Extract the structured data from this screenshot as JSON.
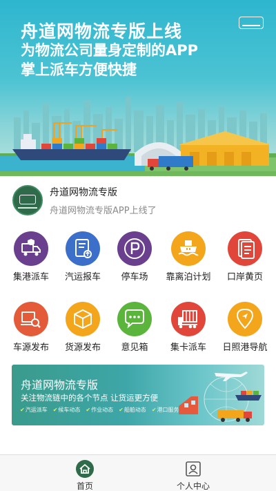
{
  "hero": {
    "line1": "舟道网物流专版上线",
    "line2": "为物流公司量身定制的APP",
    "line3": "掌上派车方便快捷"
  },
  "notice": {
    "title": "舟道网物流专版",
    "subtitle": "舟道网物流专版APP上线了"
  },
  "grid": [
    {
      "label": "集港派车",
      "icon": "truck-shield-icon",
      "color": "#6a3f8e"
    },
    {
      "label": "汽运报车",
      "icon": "document-upload-icon",
      "color": "#3b6fc9"
    },
    {
      "label": "停车场",
      "icon": "parking-icon",
      "color": "#6a3f8e"
    },
    {
      "label": "靠离泊计划",
      "icon": "ship-icon",
      "color": "#f3a51c"
    },
    {
      "label": "口岸黄页",
      "icon": "documents-icon",
      "color": "#e0473a"
    },
    {
      "label": "车源发布",
      "icon": "truck-search-icon",
      "color": "#e45b3a"
    },
    {
      "label": "货源发布",
      "icon": "cargo-box-icon",
      "color": "#f3a51c"
    },
    {
      "label": "意见箱",
      "icon": "chat-bubbles-icon",
      "color": "#5bb53c"
    },
    {
      "label": "集卡派车",
      "icon": "container-truck-icon",
      "color": "#e0473a"
    },
    {
      "label": "日照港导航",
      "icon": "location-pin-icon",
      "color": "#f3a51c"
    }
  ],
  "promo": {
    "title": "舟道网物流专版",
    "subtitle": "关注物流链中的各个节点 让货运更方便",
    "tags": [
      "汽运派车",
      "候车动态",
      "作业动态",
      "船舶动态",
      "港口服务"
    ]
  },
  "tabs": [
    {
      "label": "首页",
      "icon": "home-icon",
      "active": true
    },
    {
      "label": "个人中心",
      "icon": "user-card-icon",
      "active": false
    }
  ]
}
